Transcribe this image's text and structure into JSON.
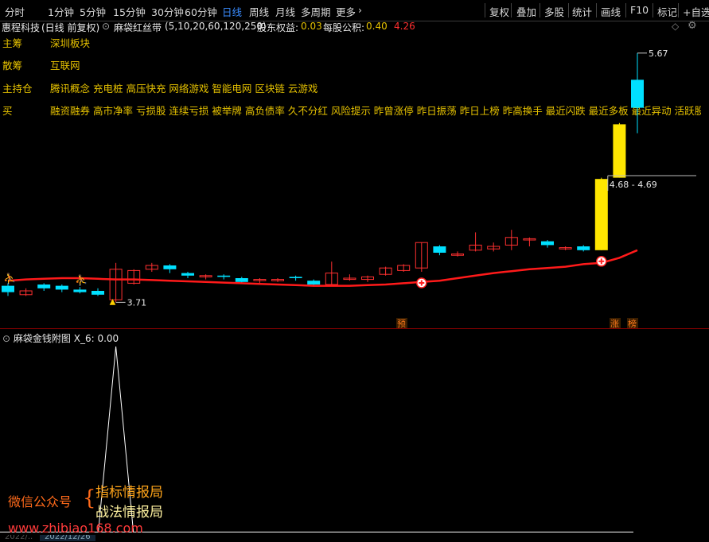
{
  "toolbar": {
    "periods": [
      "分时",
      "1分钟",
      "5分钟",
      "15分钟",
      "30分钟",
      "60分钟",
      "日线",
      "周线",
      "月线",
      "多周期",
      "更多"
    ],
    "active_period": "日线",
    "tools": [
      "复权",
      "叠加",
      "多股",
      "统计",
      "画线",
      "F10",
      "标记",
      "+自选"
    ]
  },
  "info": {
    "stock": "惠程科技",
    "mode": "(日线 前复权)",
    "indicator": "麻袋红丝带",
    "params": "(5,10,20,60,120,250)",
    "eq_label": "股东权益:",
    "eq_value": "0.03",
    "pub_label": "每股公积:",
    "pub_value": "0.40",
    "extra_value": "4.26"
  },
  "tags": [
    {
      "label": "主筹",
      "value": "深圳板块"
    },
    {
      "label": "散筹",
      "value": "互联网"
    },
    {
      "label": "主持仓",
      "value": "腾讯概念 充电桩 高压快充 网络游戏 智能电网 区块链 云游戏"
    },
    {
      "label": "买",
      "value": "融资融券 高市净率 亏损股 连续亏损 被举牌 高负债率 久不分红 风险提示 昨曾涨停 昨日振荡 昨日上榜 昨高换手 最近闪跌 最近多板 最近异动 活跃股 近期强"
    }
  ],
  "main_chart": {
    "high_label": "5.67",
    "low_label": "3.71",
    "range_label": "4.68 - 4.69",
    "markers": {
      "yu": "预",
      "zhang": "涨",
      "bang": "榜"
    }
  },
  "sub_chart": {
    "title": "麻袋金钱附图",
    "value_label": "X_6: 0.00"
  },
  "watermark": {
    "left": "微信公众号",
    "line1": "指标情报局",
    "line2": "战法情报局",
    "url": "www.zhibiao168.com"
  },
  "bottom": {
    "date1": "2022/..",
    "date2": "2022/12/26"
  },
  "colors": {
    "up": "#ff3030",
    "down": "#00e0ff",
    "ma": "#ff1a1a",
    "yellow": "#ffe600",
    "label": "#e6c200"
  },
  "chart_data": {
    "type": "candlestick",
    "ylim": [
      3.6,
      5.8
    ],
    "candles": [
      {
        "o": 3.84,
        "c": 3.79,
        "h": 3.86,
        "l": 3.76
      },
      {
        "o": 3.77,
        "c": 3.8,
        "h": 3.82,
        "l": 3.76
      },
      {
        "o": 3.85,
        "c": 3.82,
        "h": 3.86,
        "l": 3.8
      },
      {
        "o": 3.84,
        "c": 3.81,
        "h": 3.85,
        "l": 3.79
      },
      {
        "o": 3.81,
        "c": 3.79,
        "h": 3.83,
        "l": 3.78
      },
      {
        "o": 3.8,
        "c": 3.77,
        "h": 3.82,
        "l": 3.76
      },
      {
        "o": 3.73,
        "c": 3.97,
        "h": 4.02,
        "l": 3.71
      },
      {
        "o": 3.86,
        "c": 3.96,
        "h": 3.97,
        "l": 3.85
      },
      {
        "o": 3.97,
        "c": 4.0,
        "h": 4.02,
        "l": 3.95
      },
      {
        "o": 4.0,
        "c": 3.97,
        "h": 4.01,
        "l": 3.94
      },
      {
        "o": 3.94,
        "c": 3.92,
        "h": 3.95,
        "l": 3.9
      },
      {
        "o": 3.91,
        "c": 3.92,
        "h": 3.93,
        "l": 3.89
      },
      {
        "o": 3.92,
        "c": 3.91,
        "h": 3.93,
        "l": 3.89
      },
      {
        "o": 3.9,
        "c": 3.87,
        "h": 3.91,
        "l": 3.86
      },
      {
        "o": 3.89,
        "c": 3.89,
        "h": 3.9,
        "l": 3.86
      },
      {
        "o": 3.88,
        "c": 3.89,
        "h": 3.9,
        "l": 3.87
      },
      {
        "o": 3.91,
        "c": 3.9,
        "h": 3.92,
        "l": 3.88
      },
      {
        "o": 3.88,
        "c": 3.85,
        "h": 3.89,
        "l": 3.84
      },
      {
        "o": 3.85,
        "c": 3.94,
        "h": 4.03,
        "l": 3.84
      },
      {
        "o": 3.89,
        "c": 3.9,
        "h": 3.93,
        "l": 3.88
      },
      {
        "o": 3.89,
        "c": 3.91,
        "h": 3.92,
        "l": 3.87
      },
      {
        "o": 3.93,
        "c": 3.98,
        "h": 3.99,
        "l": 3.92
      },
      {
        "o": 3.96,
        "c": 4.0,
        "h": 4.01,
        "l": 3.95
      },
      {
        "o": 3.98,
        "c": 4.18,
        "h": 4.18,
        "l": 3.95
      },
      {
        "o": 4.15,
        "c": 4.1,
        "h": 4.16,
        "l": 4.08
      },
      {
        "o": 4.08,
        "c": 4.09,
        "h": 4.11,
        "l": 4.07
      },
      {
        "o": 4.12,
        "c": 4.16,
        "h": 4.26,
        "l": 4.11
      },
      {
        "o": 4.13,
        "c": 4.15,
        "h": 4.18,
        "l": 4.11
      },
      {
        "o": 4.16,
        "c": 4.22,
        "h": 4.28,
        "l": 4.12
      },
      {
        "o": 4.2,
        "c": 4.21,
        "h": 4.22,
        "l": 4.15
      },
      {
        "o": 4.19,
        "c": 4.16,
        "h": 4.2,
        "l": 4.14
      },
      {
        "o": 4.13,
        "c": 4.14,
        "h": 4.15,
        "l": 4.12
      },
      {
        "o": 4.15,
        "c": 4.12,
        "h": 4.16,
        "l": 4.11
      },
      {
        "o": 4.12,
        "c": 4.68,
        "h": 4.69,
        "l": 4.12
      },
      {
        "o": 4.69,
        "c": 5.11,
        "h": 5.12,
        "l": 4.69
      },
      {
        "o": 5.46,
        "c": 5.24,
        "h": 5.67,
        "l": 5.04
      }
    ],
    "ma_line": [
      3.88,
      3.89,
      3.895,
      3.9,
      3.9,
      3.895,
      3.89,
      3.89,
      3.885,
      3.88,
      3.875,
      3.87,
      3.865,
      3.86,
      3.855,
      3.85,
      3.845,
      3.84,
      3.84,
      3.84,
      3.845,
      3.85,
      3.86,
      3.87,
      3.88,
      3.9,
      3.92,
      3.94,
      3.955,
      3.97,
      3.98,
      3.99,
      4.01,
      4.02,
      4.06,
      4.12
    ],
    "sub_series": [
      0,
      0,
      0,
      0,
      0,
      0,
      1,
      0,
      0,
      0,
      0,
      0,
      0,
      0,
      0,
      0,
      0,
      0,
      0,
      0,
      0,
      0,
      0,
      0,
      0,
      0,
      0,
      0,
      0,
      0,
      0,
      0,
      0,
      0,
      0,
      0
    ]
  }
}
